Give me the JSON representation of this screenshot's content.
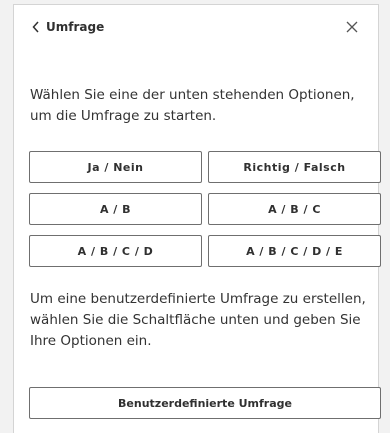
{
  "header": {
    "back_label": "Umfrage"
  },
  "intro_text": "Wählen Sie eine der unten stehenden Optionen, um die Umfrage zu starten.",
  "options": [
    "Ja / Nein",
    "Richtig / Falsch",
    "A / B",
    "A / B / C",
    "A / B / C / D",
    "A / B / C / D / E"
  ],
  "custom_text": "Um eine benutzerdefinierte Umfrage zu erstellen, wählen Sie die Schaltfläche unten und geben Sie Ihre Optionen ein.",
  "custom_button_label": "Benutzerdefinierte Umfrage"
}
